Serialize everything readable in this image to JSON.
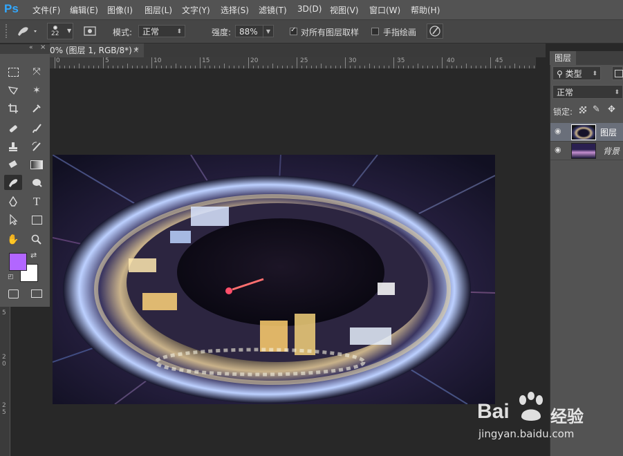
{
  "app": {
    "logo": "Ps"
  },
  "menu": [
    "文件(F)",
    "编辑(E)",
    "图像(I)",
    "图层(L)",
    "文字(Y)",
    "选择(S)",
    "滤镜(T)",
    "3D(D)",
    "视图(V)",
    "窗口(W)",
    "帮助(H)"
  ],
  "options": {
    "brush_size": "22",
    "mode_label": "模式:",
    "mode_value": "正常",
    "strength_label": "强度:",
    "strength_value": "88%",
    "sample_all_layers": {
      "label": "对所有图层取样",
      "checked": true
    },
    "finger_painting": {
      "label": "手指绘画",
      "checked": false
    }
  },
  "document": {
    "tab_title": "0% (图层 1, RGB/8*) *"
  },
  "ruler": {
    "h_labels": [
      "0",
      "5",
      "10",
      "15",
      "20",
      "25",
      "30",
      "35",
      "40",
      "45"
    ],
    "v_labels": [
      "5",
      "2",
      "0",
      "2",
      "5"
    ]
  },
  "toolbox": {
    "foreground_color": "#b266ff",
    "background_color": "#ffffff"
  },
  "layers_panel": {
    "tab": "图层",
    "kind_filter": "类型",
    "blend_mode": "正常",
    "lock_label": "锁定:",
    "layers": [
      {
        "name": "图层",
        "selected": true
      },
      {
        "name": "背景",
        "selected": false
      }
    ]
  },
  "watermark": {
    "brand": "Bai",
    "suffix": "经验",
    "url": "jingyan.baidu.com"
  },
  "colors": {
    "ps_blue": "#31a8ff",
    "ui_dark": "#282828",
    "ui_panel": "#535353"
  }
}
